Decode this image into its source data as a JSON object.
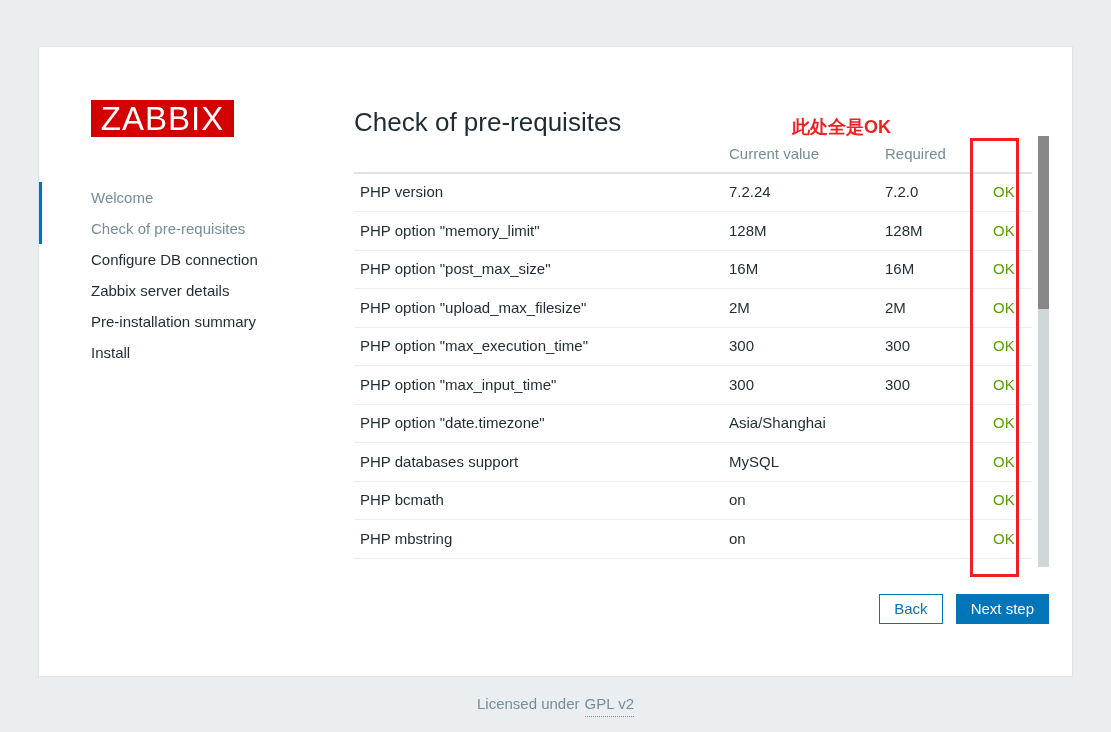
{
  "logo": "ZABBIX",
  "steps": [
    {
      "label": "Welcome",
      "completed": true
    },
    {
      "label": "Check of pre-requisites",
      "completed": true
    },
    {
      "label": "Configure DB connection",
      "completed": false
    },
    {
      "label": "Zabbix server details",
      "completed": false
    },
    {
      "label": "Pre-installation summary",
      "completed": false
    },
    {
      "label": "Install",
      "completed": false
    }
  ],
  "title": "Check of pre-requisites",
  "table": {
    "columns": [
      "Current value",
      "Required"
    ],
    "rows": [
      {
        "name": "PHP version",
        "current": "7.2.24",
        "required": "7.2.0",
        "result": "OK"
      },
      {
        "name": "PHP option \"memory_limit\"",
        "current": "128M",
        "required": "128M",
        "result": "OK"
      },
      {
        "name": "PHP option \"post_max_size\"",
        "current": "16M",
        "required": "16M",
        "result": "OK"
      },
      {
        "name": "PHP option \"upload_max_filesize\"",
        "current": "2M",
        "required": "2M",
        "result": "OK"
      },
      {
        "name": "PHP option \"max_execution_time\"",
        "current": "300",
        "required": "300",
        "result": "OK"
      },
      {
        "name": "PHP option \"max_input_time\"",
        "current": "300",
        "required": "300",
        "result": "OK"
      },
      {
        "name": "PHP option \"date.timezone\"",
        "current": "Asia/Shanghai",
        "result": "OK"
      },
      {
        "name": "PHP databases support",
        "current": "MySQL",
        "result": "OK"
      },
      {
        "name": "PHP bcmath",
        "current": "on",
        "result": "OK"
      },
      {
        "name": "PHP mbstring",
        "current": "on",
        "result": "OK"
      }
    ]
  },
  "annotation": "此处全是OK",
  "buttons": {
    "back": "Back",
    "next": "Next step"
  },
  "footer": {
    "text": "Licensed under",
    "link": "GPL v2"
  }
}
